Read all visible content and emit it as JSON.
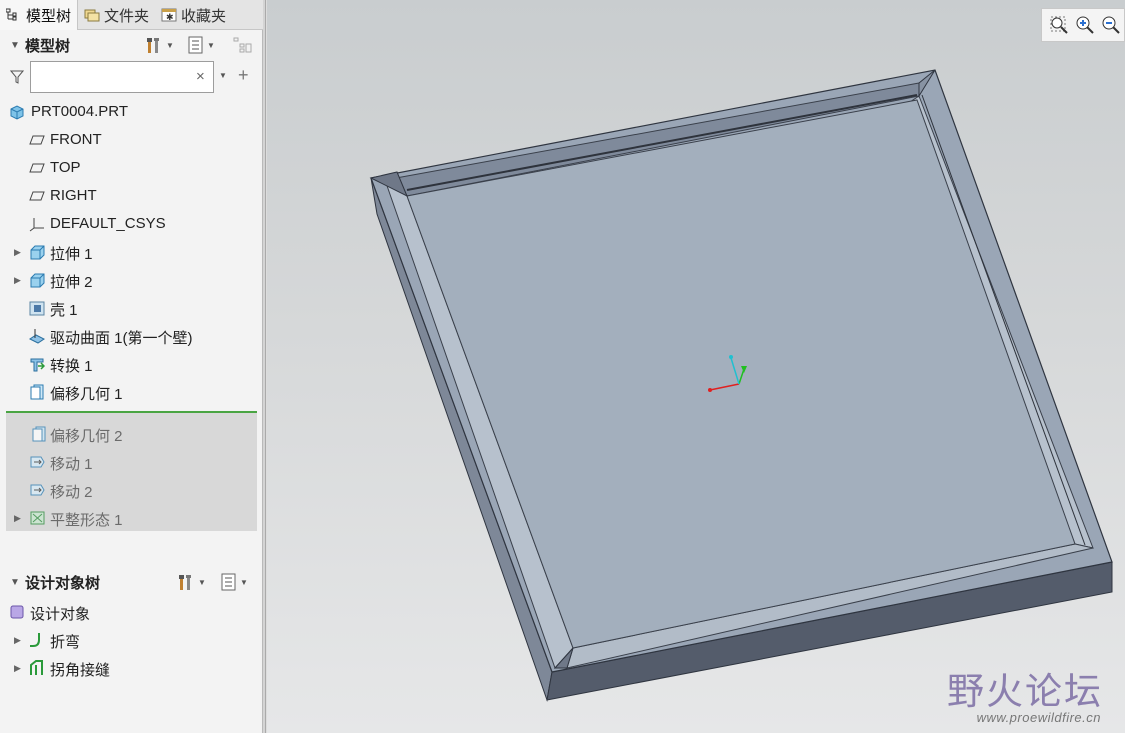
{
  "tabs": [
    {
      "label": "模型树",
      "icon": "tree-icon",
      "active": true
    },
    {
      "label": "文件夹",
      "icon": "folder-icon",
      "active": false
    },
    {
      "label": "收藏夹",
      "icon": "favorites-icon",
      "active": false
    }
  ],
  "model_tree": {
    "title": "模型树",
    "search": {
      "value": "",
      "placeholder": ""
    },
    "root": "PRT0004.PRT",
    "items": [
      {
        "label": "FRONT",
        "icon": "datum-plane-icon"
      },
      {
        "label": "TOP",
        "icon": "datum-plane-icon"
      },
      {
        "label": "RIGHT",
        "icon": "datum-plane-icon"
      },
      {
        "label": "DEFAULT_CSYS",
        "icon": "csys-icon"
      },
      {
        "label": "拉伸 1",
        "icon": "extrude-icon",
        "expandable": true
      },
      {
        "label": "拉伸 2",
        "icon": "extrude-icon",
        "expandable": true
      },
      {
        "label": "壳 1",
        "icon": "shell-icon"
      },
      {
        "label": "驱动曲面 1(第一个壁)",
        "icon": "driving-surface-icon"
      },
      {
        "label": "转换 1",
        "icon": "convert-icon"
      },
      {
        "label": "偏移几何 1",
        "icon": "offset-geometry-icon"
      }
    ],
    "suppressed_items": [
      {
        "label": "偏移几何 2",
        "icon": "offset-geometry-icon"
      },
      {
        "label": "移动 1",
        "icon": "move-icon"
      },
      {
        "label": "移动 2",
        "icon": "move-icon"
      },
      {
        "label": "平整形态 1",
        "icon": "flat-state-icon",
        "expandable": true
      }
    ]
  },
  "design_tree": {
    "title": "设计对象树",
    "root": "设计对象",
    "items": [
      {
        "label": "折弯",
        "icon": "bend-icon",
        "expandable": true
      },
      {
        "label": "拐角接缝",
        "icon": "corner-seam-icon",
        "expandable": true
      }
    ]
  },
  "viewport_tools": [
    "zoom-fit-icon",
    "zoom-in-icon",
    "zoom-out-icon"
  ],
  "watermark": {
    "title": "野火论坛",
    "url": "www.proewildfire.cn"
  },
  "colors": {
    "accent_line": "#4aa543",
    "part_face": "#a3afbd",
    "part_side": "#5c6474",
    "axis_x": "#e02020",
    "axis_y": "#20c020",
    "axis_z": "#20c0d0"
  }
}
